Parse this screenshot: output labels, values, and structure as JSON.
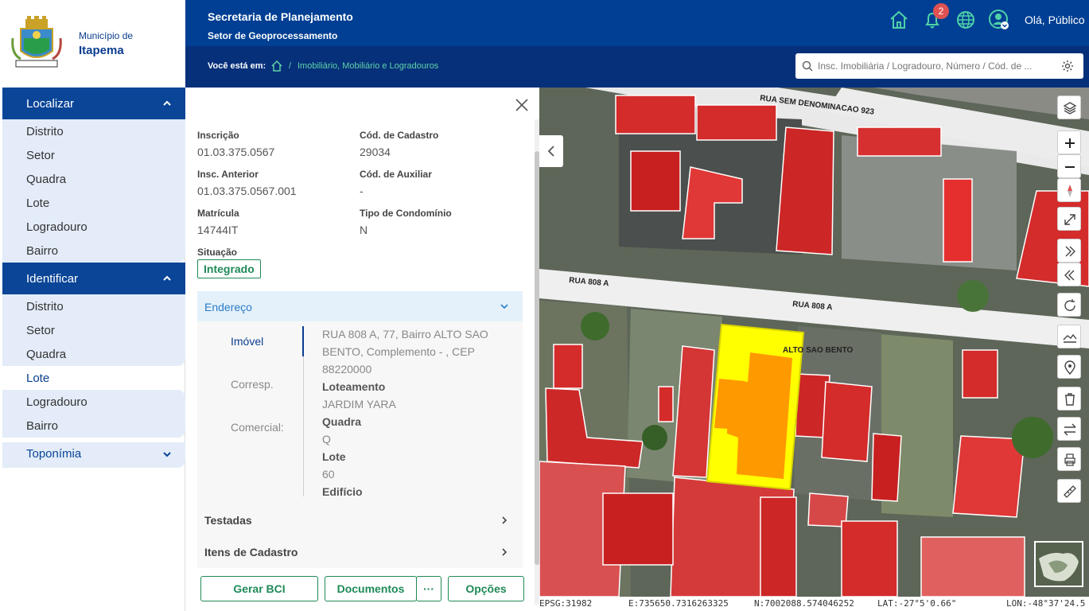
{
  "header": {
    "municipality_label": "Município de",
    "municipality_name": "Itapema",
    "title": "Secretaria de Planejamento",
    "subtitle": "Setor de Geoprocessamento",
    "notification_count": "2",
    "greeting": "Olá, Público",
    "breadcrumb_label": "Você está em:",
    "breadcrumb_separator": "/",
    "breadcrumb_current": "Imobiliário, Mobiliário e Logradouros",
    "search_placeholder": "Insc. Imobiliária / Logradouro, Número / Cód. de ..."
  },
  "sidebar": {
    "localizar": {
      "title": "Localizar",
      "items": [
        "Distrito",
        "Setor",
        "Quadra",
        "Lote",
        "Logradouro",
        "Bairro"
      ]
    },
    "identificar": {
      "title": "Identificar",
      "items": [
        "Distrito",
        "Setor",
        "Quadra",
        "Lote",
        "Logradouro",
        "Bairro"
      ],
      "active_item": "Lote"
    },
    "toponimia": "Toponímia"
  },
  "details": {
    "inscricao_label": "Inscrição",
    "inscricao_value": "01.03.375.0567",
    "cod_cadastro_label": "Cód. de Cadastro",
    "cod_cadastro_value": "29034",
    "insc_anterior_label": "Insc. Anterior",
    "insc_anterior_value": "01.03.375.0567.001",
    "cod_auxiliar_label": "Cód. de Auxiliar",
    "cod_auxiliar_value": "-",
    "matricula_label": "Matrícula",
    "matricula_value": "14744IT",
    "tipo_condominio_label": "Tipo de Condomínio",
    "tipo_condominio_value": "N",
    "situacao_label": "Situação",
    "situacao_value": "Integrado",
    "endereco": {
      "title": "Endereço",
      "tabs": [
        "Imóvel",
        "Corresp.",
        "Comercial:"
      ],
      "lines": [
        {
          "text": "RUA 808 A, 77, Bairro ALTO SAO",
          "bold": false
        },
        {
          "text": "BENTO, Complemento - , CEP",
          "bold": false
        },
        {
          "text": "88220000",
          "bold": false
        },
        {
          "text": "Loteamento",
          "bold": true
        },
        {
          "text": "JARDIM YARA",
          "bold": false
        },
        {
          "text": "Quadra",
          "bold": true
        },
        {
          "text": "Q",
          "bold": false
        },
        {
          "text": "Lote",
          "bold": true
        },
        {
          "text": "60",
          "bold": false
        },
        {
          "text": "Edifício",
          "bold": true
        }
      ]
    },
    "testadas_label": "Testadas",
    "itens_cadastro_label": "Itens de Cadastro",
    "buttons": {
      "gerar_bci": "Gerar BCI",
      "documentos": "Documentos",
      "more": "···",
      "opcoes": "Opções"
    }
  },
  "map": {
    "street_labels": [
      "RUA SEM DENOMINACAO 923",
      "RUA 808 A",
      "RUA 808 A"
    ],
    "bairro_label": "ALTO SAO BENTO",
    "tools": [
      "layers-icon",
      "zoom-in-icon",
      "zoom-out-icon",
      "compass-icon",
      "fullscreen-icon",
      "next-extent-icon",
      "previous-extent-icon",
      "refresh-icon",
      "terrain-icon",
      "location-icon",
      "trash-icon",
      "swap-icon",
      "print-icon",
      "ruler-icon"
    ],
    "coords": {
      "epsg": "EPSG:31982",
      "east": "E:735650.7316263325",
      "north": "N:7002088.574046252",
      "lat": "LAT:-27°5'0.66\"",
      "lon": "LON:-48°37'24.5"
    }
  },
  "colors": {
    "primary": "#003f93",
    "accent_green": "#1f8a57",
    "building_red": "#d42b2b",
    "selected_lot": "#ffff00",
    "selected_building": "#ff9900"
  }
}
